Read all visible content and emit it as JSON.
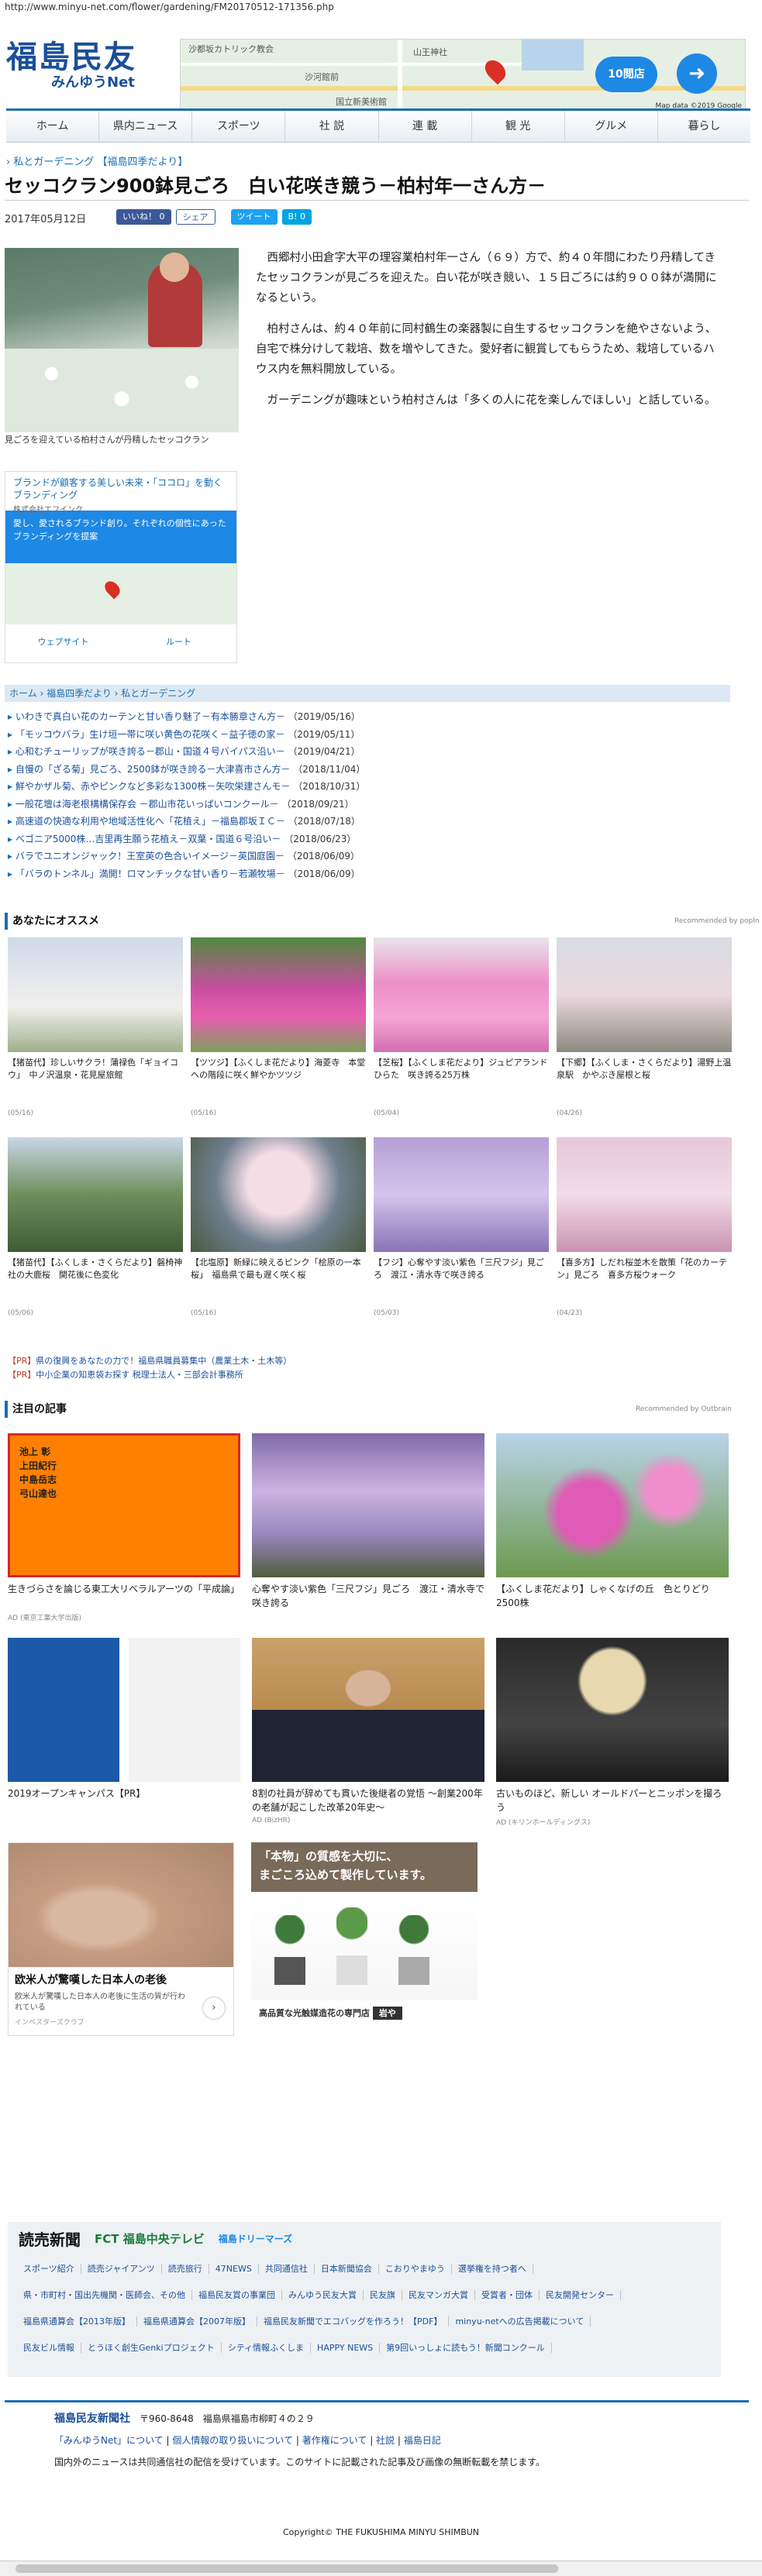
{
  "url": "http://www.minyu-net.com/flower/gardening/FM20170512-171356.php",
  "logo": {
    "main": "福島民友",
    "sub": "みんゆうNet"
  },
  "map_ad": {
    "labels": [
      "沙都坂カトリック教会",
      "山王神社",
      "沙河館前",
      "国立新美術館"
    ],
    "store_btn": "10閲店",
    "credit": "Map data ©2019 Google"
  },
  "nav": [
    "ホーム",
    "県内ニュース",
    "スポーツ",
    "社 説",
    "連 載",
    "観 光",
    "グルメ",
    "暮らし"
  ],
  "crumb": {
    "cat": "私とガーデニング",
    "sub": "【福島四季だより】"
  },
  "article": {
    "title": "セッコクラン900鉢見ごろ　白い花咲き競う－柏村年一さん方－",
    "date": "2017年05月12日",
    "share": {
      "fb": "いいね！ 0",
      "share": "シェア",
      "tweet": "ツイート",
      "hb": "B! 0"
    },
    "caption": "見ごろを迎えている柏村さんが丹精したセッコクラン",
    "paragraphs": [
      "西郷村小田倉字大平の理容業柏村年一さん（６９）方で、約４０年間にわたり丹精してきたセッコクランが見ごろを迎えた。白い花が咲き競い、１５日ごろには約９００鉢が満開になるという。",
      "柏村さんは、約４０年前に同村鶴生の楽器製に自生するセッコクランを絶やさないよう、自宅で株分けして栽培、数を増やしてきた。愛好者に観賞してもらうため、栽培しているハウス内を無料開放している。",
      "ガーデニングが趣味という柏村さんは「多くの人に花を楽しんでほしい」と話している。"
    ]
  },
  "side_ad": {
    "t1": "ブランドが顧客する美しい未来・「ココロ」を動くブランディング",
    "t2": "株式会社エフインク",
    "blue": "愛し、愛されるブランド創り。それぞれの個性にあったブランディングを提案",
    "btn_web": "ウェブサイト",
    "btn_route": "ルート"
  },
  "crumb_bar": {
    "home": "ホーム",
    "a": "福島四季だより",
    "b": "私とガーデニング"
  },
  "related": [
    {
      "t": "いわきで真白い花のカーテンと甘い香り魅了－有本勝章さん方－",
      "d": "（2019/05/16）"
    },
    {
      "t": "「モッコウバラ」生け垣一帯に咲い黄色の花咲く－益子徳の家－",
      "d": "（2019/05/11）"
    },
    {
      "t": "心和むチューリップが咲き誇る－郡山・国道４号バイパス沿い－",
      "d": "（2019/04/21）"
    },
    {
      "t": "自慢の「ざる菊」見ごろ、2500鉢が咲き誇る－大津喜市さん方－",
      "d": "（2018/11/04）"
    },
    {
      "t": "鮮やかザル菊、赤やピンクなど多彩な1300株－矢吹栄建さんモ－",
      "d": "（2018/10/31）"
    },
    {
      "t": "一般花壇は海老根構構保存会 －郡山市花いっぱいコンクール－",
      "d": "（2018/09/21）"
    },
    {
      "t": "高速道の快適な利用や地域活性化へ「花植え」－福島郡坂ＩＣ－",
      "d": "（2018/07/18）"
    },
    {
      "t": "ベゴニア5000株…吉里再生願う花植え－双葉・国道６号沿い－",
      "d": "（2018/06/23）"
    },
    {
      "t": "バラでユニオンジャック！王室英の色合いイメージ－英国庭園－",
      "d": "（2018/06/09）"
    },
    {
      "t": "「バラのトンネル」満開！ロマンチックな甘い香り－若瀬牧場－",
      "d": "（2018/06/09）"
    }
  ],
  "recommend": {
    "heading": "あなたにオススメ",
    "by": "Recommended by popIn",
    "items": [
      {
        "t": "【猪苗代】珍しいサクラ！蒲禄色「ギョイコウ」　中ノ沢温泉・花見屋旅館",
        "d": "(05/16)"
      },
      {
        "t": "【ツツジ】【ふくしま花だより】海菱寺　本堂への階段に咲く鮮やかツツジ",
        "d": "(05/16)"
      },
      {
        "t": "【芝桜】【ふくしま花だより】ジュピアランドひらた　咲き誇る25万株",
        "d": "(05/04)"
      },
      {
        "t": "【下郷】【ふくしま・さくらだより】湯野上温泉駅　かやぶき屋根と桜",
        "d": "(04/26)"
      },
      {
        "t": "【猪苗代】【ふくしま・さくらだより】磐椅神社の大鹿桜　開花後に色変化",
        "d": "(05/06)"
      },
      {
        "t": "【北塩原】新緑に映えるピンク「桧原の一本桜」　福島県で最も遅く咲く桜",
        "d": "(05/16)"
      },
      {
        "t": "【フジ】心奪やす淡い紫色「三尺フジ」見ごろ　渡江・清水寺で咲き誇る",
        "d": "(05/03)"
      },
      {
        "t": "【喜多方】しだれ桜並木を散策「花のカーテン」見ごろ　喜多方桜ウォーク",
        "d": "(04/23)"
      }
    ]
  },
  "pr": [
    {
      "tag": "【PR】",
      "t": "県の復興をあなたの力で！福島県職員募集中（農業土木・土木等）"
    },
    {
      "tag": "【PR】",
      "t": "中小企業の知恵袋お探す 税理士法人・三部会計事務所"
    }
  ],
  "notable": {
    "heading": "注目の記事",
    "by": "Recommended by Outbrain",
    "items": [
      {
        "t": "生きづらさを論じる東工大リベラルアーツの「平成論」",
        "s": "AD (東京工業大学出版)"
      },
      {
        "t": "心奪やす淡い紫色「三尺フジ」見ごろ　渡江・清水寺で咲き誇る",
        "s": ""
      },
      {
        "t": "【ふくしま花だより】しゃくなげの丘　色とりどり2500株",
        "s": ""
      },
      {
        "t": "2019オープンキャンパス【PR】",
        "s": ""
      },
      {
        "t": "8割の社員が辞めても貫いた後継者の覚悟 ～創業200年の老舗が起こした改革20年史～",
        "s": "AD (BizHR)"
      },
      {
        "t": "古いものほど、新しい オールドパーとニッポンを撮ろう",
        "s": "AD (キリンホールディングス)"
      }
    ],
    "book_lines": [
      "池上 彰",
      "上田紀行",
      "中島岳志",
      "弓山達也"
    ]
  },
  "ads": {
    "left_title": "欧米人が驚嘆した日本人の老後",
    "left_sub": "欧米人が驚嘆した日本人の老後に生活の質が行われている",
    "left_src": "インベスターズクラブ",
    "right_text1": "「本物」の質感を大切に、",
    "right_text2": "まごころ込めて製作しています。",
    "right_bottom": "高品質な光触媒造花の専門店",
    "right_brand": "岩や"
  },
  "footer": {
    "logos": [
      "読売新聞",
      "FCT 福島中央テレビ",
      "福島ドリーマーズ"
    ],
    "links": [
      "スポーツ紹介",
      "読売ジャイアンツ",
      "読売旅行",
      "47NEWS",
      "共同通信社",
      "日本新聞協会",
      "こおりやまゆう",
      "選挙権を持つ者へ",
      "県・市町村・国出先機関・医師会、その他",
      "福島民友賞の事業団",
      "みんゆう民友大賞",
      "民友旗",
      "民友マンガ大賞",
      "受賞者・団体",
      "民友開発センター",
      "福島県通算会【2013年版】",
      "福島県通算会【2007年版】",
      "福島民友新聞でエコバッグを作ろう！【PDF】",
      "minyu-netへの広告掲載について",
      "民友ビル情報",
      "とうほく創生Genkiプロジェクト",
      "シティ情報ふくしま",
      "HAPPY NEWS",
      "第9回いっしょに読もう！新聞コンクール"
    ],
    "company": "福島民友新聞社",
    "address": "〒960-8648　福島県福島市柳町４の２９",
    "links2": [
      "「みんゆうNet」について",
      "個人情報の取り扱いについて",
      "著作権について",
      "社説",
      "福島日記"
    ],
    "notice": "国内外のニュースは共同通信社の配信を受けています。このサイトに記載された記事及び画像の無断転載を禁じます。",
    "copyright": "Copyright© THE FUKUSHIMA MINYU SHIMBUN"
  }
}
